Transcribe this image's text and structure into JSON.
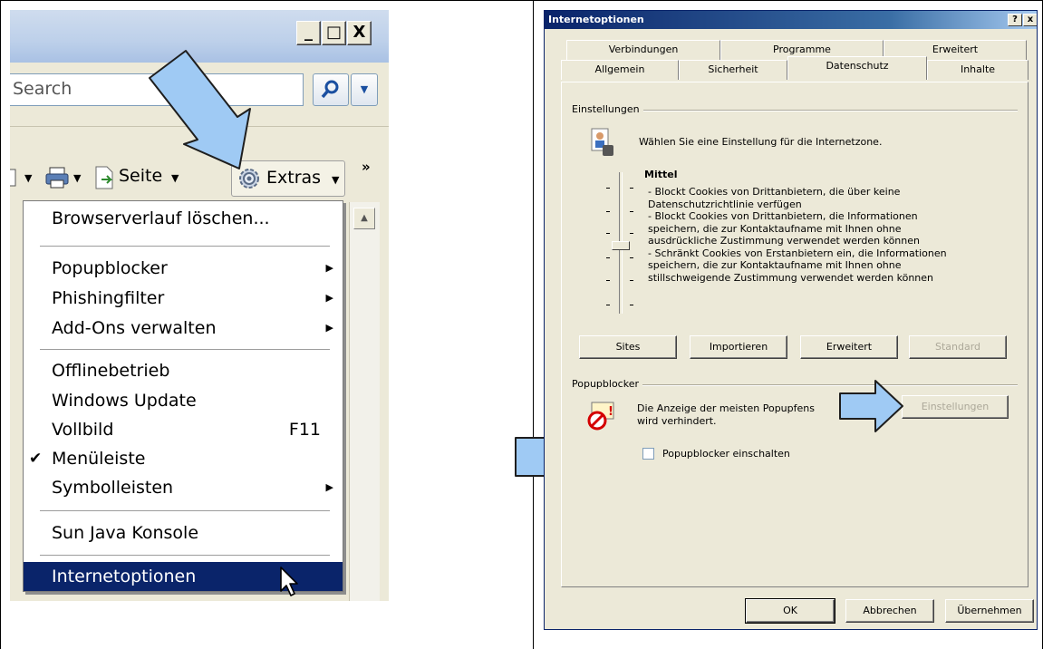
{
  "left": {
    "search": {
      "placeholder": "Search"
    },
    "toolbar": {
      "seite_label": "Seite",
      "extras_label": "Extras",
      "more_symbol": "»"
    },
    "menu": {
      "items": [
        {
          "label": "Browserverlauf löschen..."
        },
        {
          "label": "Popupblocker",
          "submenu": true
        },
        {
          "label": "Phishingfilter",
          "submenu": true
        },
        {
          "label": "Add-Ons verwalten",
          "submenu": true
        },
        {
          "label": "Offlinebetrieb"
        },
        {
          "label": "Windows Update"
        },
        {
          "label": "Vollbild",
          "shortcut": "F11"
        },
        {
          "label": "Menüleiste",
          "checked": true
        },
        {
          "label": "Symbolleisten",
          "submenu": true
        },
        {
          "label": "Sun Java Konsole"
        },
        {
          "label": "Internetoptionen",
          "highlighted": true
        }
      ],
      "check_glyph": "✔",
      "submenu_glyph": "▶"
    },
    "window_buttons": {
      "minimize": "_",
      "maximize": "□",
      "close": "X"
    }
  },
  "dialog": {
    "title": "Internetoptionen",
    "title_buttons": {
      "help": "?",
      "close": "x"
    },
    "tabs_back": [
      "Verbindungen",
      "Programme",
      "Erweitert"
    ],
    "tabs_front": [
      "Allgemein",
      "Sicherheit",
      "Datenschutz",
      "Inhalte"
    ],
    "active_tab": "Datenschutz",
    "settings": {
      "group_label": "Einstellungen",
      "description": "Wählen Sie eine Einstellung für die Internetzone.",
      "level_name": "Mittel",
      "level_lines": [
        "- Blockt Cookies von Drittanbietern, die über keine",
        "Datenschutzrichtlinie verfügen",
        "- Blockt Cookies von Drittanbietern, die Informationen",
        "speichern, die zur Kontaktaufname mit Ihnen ohne",
        "ausdrückliche Zustimmung verwendet werden können",
        "- Schränkt Cookies von Erstanbietern ein, die Informationen",
        "speichern, die zur Kontaktaufname mit Ihnen ohne",
        "stillschweigende Zustimmung verwendet werden können"
      ],
      "buttons": {
        "sites": "Sites",
        "import": "Importieren",
        "advanced": "Erweitert",
        "default": "Standard"
      }
    },
    "popup": {
      "group_label": "Popupblocker",
      "text_line1": "Die Anzeige der meisten Popupfens",
      "text_line2": "wird verhindert.",
      "settings_button": "Einstellungen",
      "checkbox_label": "Popupblocker einschalten",
      "checkbox_checked": false
    },
    "footer": {
      "ok": "OK",
      "cancel": "Abbrechen",
      "apply": "Übernehmen"
    }
  },
  "colors": {
    "arrow_fill": "#9fcaf4",
    "arrow_stroke": "#1e1e1e",
    "menu_highlight": "#0a246a"
  }
}
